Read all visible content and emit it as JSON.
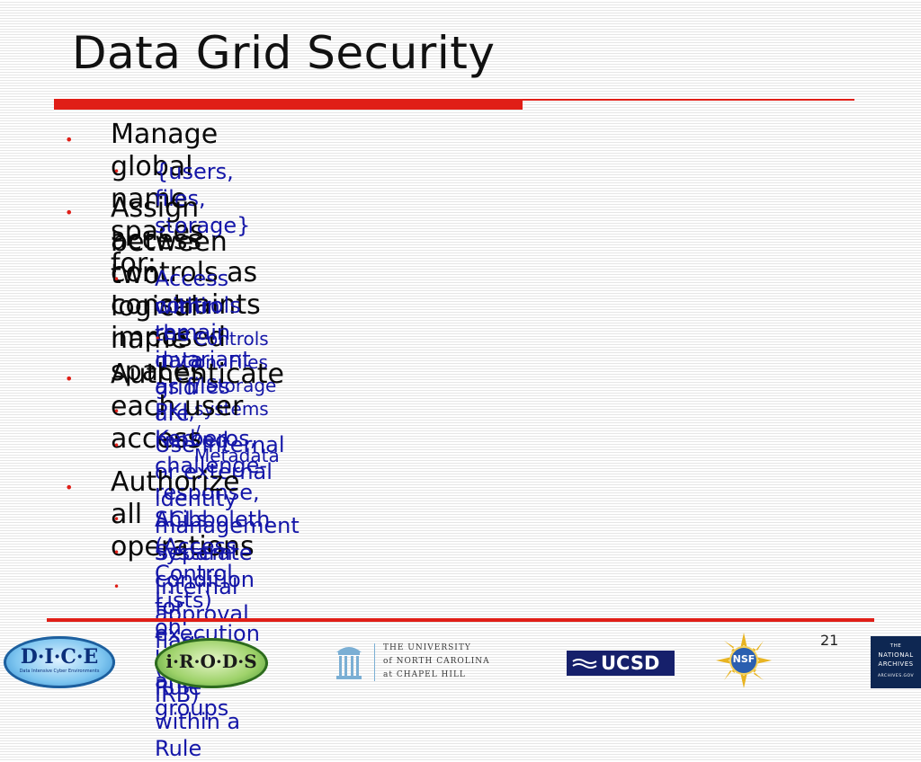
{
  "slide": {
    "title": "Data Grid Security",
    "page_number": "21"
  },
  "bullets": [
    {
      "level": 1,
      "text": "Manage global name spaces for:"
    },
    {
      "level": 2,
      "text": "{users, files, storage}"
    },
    {
      "level": 1,
      "text": "Assign access controls as constraints imposed",
      "text2": "between two logical name spaces"
    },
    {
      "level": 2,
      "text": "Access controls remain invariant as files are moved",
      "text2": "within the data grid"
    },
    {
      "level": 3,
      "text": "Controls on: Files / Storage systems / Metadata"
    },
    {
      "level": 1,
      "text": "Authenticate each user access"
    },
    {
      "level": 2,
      "text": "PKI, Kerberos, challenge-response, Shibboleth"
    },
    {
      "level": 2,
      "text": "Use internal or external identity management system"
    },
    {
      "level": 1,
      "text": "Authorize all operations"
    },
    {
      "level": 2,
      "text": "ACLs (Access Control Lists) on users and groups"
    },
    {
      "level": 2,
      "text": "Separate condition for execution of each Rule"
    },
    {
      "level": 2,
      "text": "Internal approval flags (e.g. IRB) within a Rule"
    }
  ],
  "bullet_glyph": "•",
  "logos": {
    "dice": {
      "text": "D·I·C·E",
      "sub": "Data Intensive Cyber Environments"
    },
    "irods": {
      "text": "i·R·O·D·S"
    },
    "unc": {
      "line1": "THE UNIVERSITY",
      "line2": "of NORTH CAROLINA",
      "line3": "at CHAPEL HILL"
    },
    "ucsd": {
      "text": "UCSD"
    },
    "nsf": {
      "text": "NSF"
    },
    "archives": {
      "line1": "THE",
      "line2": "NATIONAL",
      "line3": "ARCHIVES",
      "line4": "ARCHIVES.GOV"
    }
  },
  "colors": {
    "accent_red": "#e01e17",
    "sub_bullet_blue": "#1416a8",
    "text_dark": "#0a0a0a"
  }
}
